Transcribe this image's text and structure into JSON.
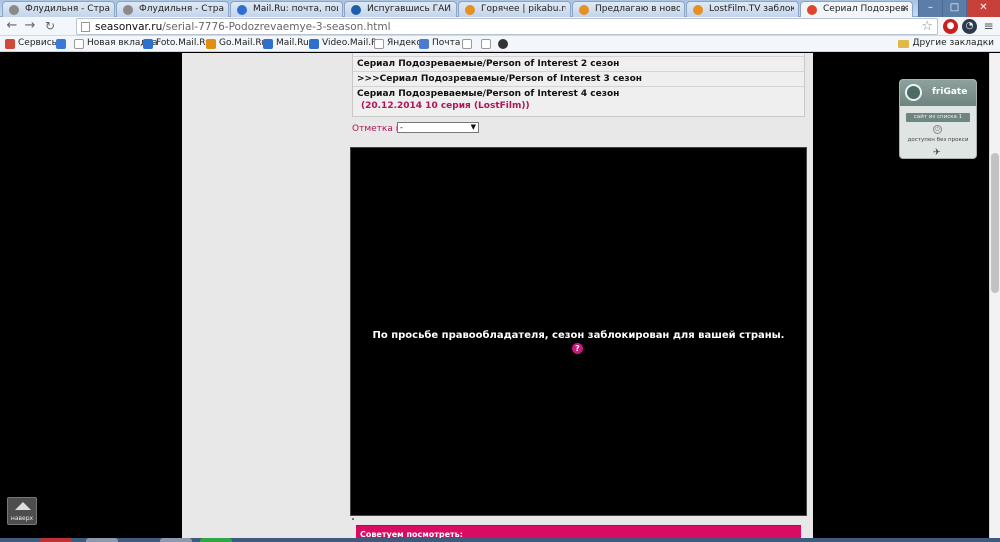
{
  "tabs": [
    {
      "label": "Флудильня - Страница",
      "active": false,
      "favicon_color": "#8a8a8a"
    },
    {
      "label": "Флудильня - Страница",
      "active": false,
      "favicon_color": "#8a8a8a"
    },
    {
      "label": "Mail.Ru: почта, поиск в",
      "active": false,
      "favicon_color": "#2f6fce"
    },
    {
      "label": "Испугавшись ГАИ, так",
      "active": false,
      "favicon_color": "#1f5fa8"
    },
    {
      "label": "Горячее | pikabu.ru - В",
      "active": false,
      "favicon_color": "#e4911f"
    },
    {
      "label": "Предлагаю в новогодн",
      "active": false,
      "favicon_color": "#e4911f"
    },
    {
      "label": "LostFilm.TV заблокиров",
      "active": false,
      "favicon_color": "#e4911f"
    },
    {
      "label": "Сериал Подозреваемые",
      "active": true,
      "favicon_color": "#e0452c"
    }
  ],
  "toolbar": {
    "url_domain": "seasonvar.ru",
    "url_path": "/serial-7776-Podozrevaemye-3-season.html"
  },
  "bookmarks": {
    "items": [
      {
        "label": "Сервисы",
        "icon_color": "#d04a3a"
      },
      {
        "label": "",
        "icon_color": "#3b78d8"
      },
      {
        "label": "Новая вкладка",
        "icon_color": "#ffffff"
      },
      {
        "label": "Foto.Mail.Ru",
        "icon_color": "#2f6fce"
      },
      {
        "label": "Go.Mail.Ru",
        "icon_color": "#e38d13"
      },
      {
        "label": "Mail.Ru",
        "icon_color": "#2f6fce"
      },
      {
        "label": "Video.Mail.Ru",
        "icon_color": "#2f6fce"
      },
      {
        "label": "Яндекс",
        "icon_color": "#ffffff"
      },
      {
        "label": "Почта",
        "icon_color": "#4a7bd0"
      },
      {
        "label": "",
        "icon_color": "#ffffff"
      },
      {
        "label": "",
        "icon_color": "#333333"
      }
    ],
    "other": "Другие закладки"
  },
  "page": {
    "seasons": [
      {
        "label": "Сериал Подозреваемые/Person of Interest 2 сезон"
      },
      {
        "label": ">>>Сериал Подозреваемые/Person of Interest 3 сезон"
      },
      {
        "label": "Сериал Подозреваемые/Person of Interest 4 сезон",
        "date": "(20.12.2014 10 серия (LostFilm))"
      }
    ],
    "mark_label": "Отметка на:",
    "mark_value": "-",
    "blocked_message": "По просьбе правообладателя, сезон заблокирован для вашей страны.",
    "help_glyph": "?",
    "recommend_title": "Советуем посмотреть:",
    "up_button": "наверх"
  },
  "frigate": {
    "title": "friGate",
    "list_badge": "сайт из списка 1",
    "status": "доступен без прокси"
  },
  "colors": {
    "accent_pink": "#d90b63",
    "date_pink": "#b0145a"
  }
}
